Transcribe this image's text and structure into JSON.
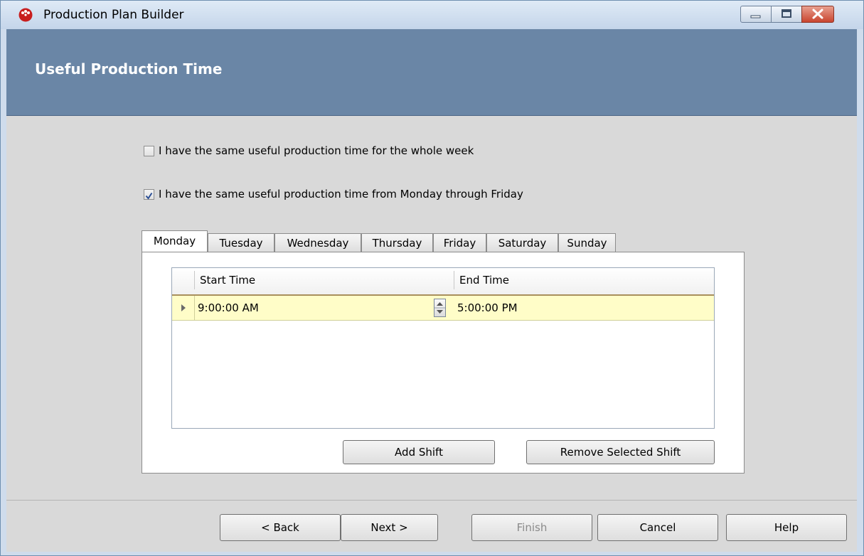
{
  "window": {
    "title": "Production Plan Builder",
    "icon": "red-dots-app-icon"
  },
  "banner": {
    "title": "Useful Production Time"
  },
  "options": {
    "whole_week": {
      "label": "I have the same useful production time for the whole week",
      "checked": false
    },
    "mon_fri": {
      "label": "I have the same useful production time from Monday through Friday",
      "checked": true
    }
  },
  "tabs": [
    {
      "label": "Monday",
      "active": true
    },
    {
      "label": "Tuesday",
      "active": false
    },
    {
      "label": "Wednesday",
      "active": false
    },
    {
      "label": "Thursday",
      "active": false
    },
    {
      "label": "Friday",
      "active": false
    },
    {
      "label": "Saturday",
      "active": false
    },
    {
      "label": "Sunday",
      "active": false
    }
  ],
  "grid": {
    "columns": [
      "Start Time",
      "End Time"
    ],
    "rows": [
      {
        "start": "9:00:00 AM",
        "end": "5:00:00 PM"
      }
    ]
  },
  "shift_buttons": {
    "add": "Add Shift",
    "remove": "Remove Selected Shift"
  },
  "wizard_buttons": {
    "back": "< Back",
    "next": "Next >",
    "finish": "Finish",
    "cancel": "Cancel",
    "help": "Help"
  },
  "colors": {
    "banner": "#6a86a6",
    "row_highlight": "#fffdc8",
    "content_bg": "#d9d9d9"
  }
}
